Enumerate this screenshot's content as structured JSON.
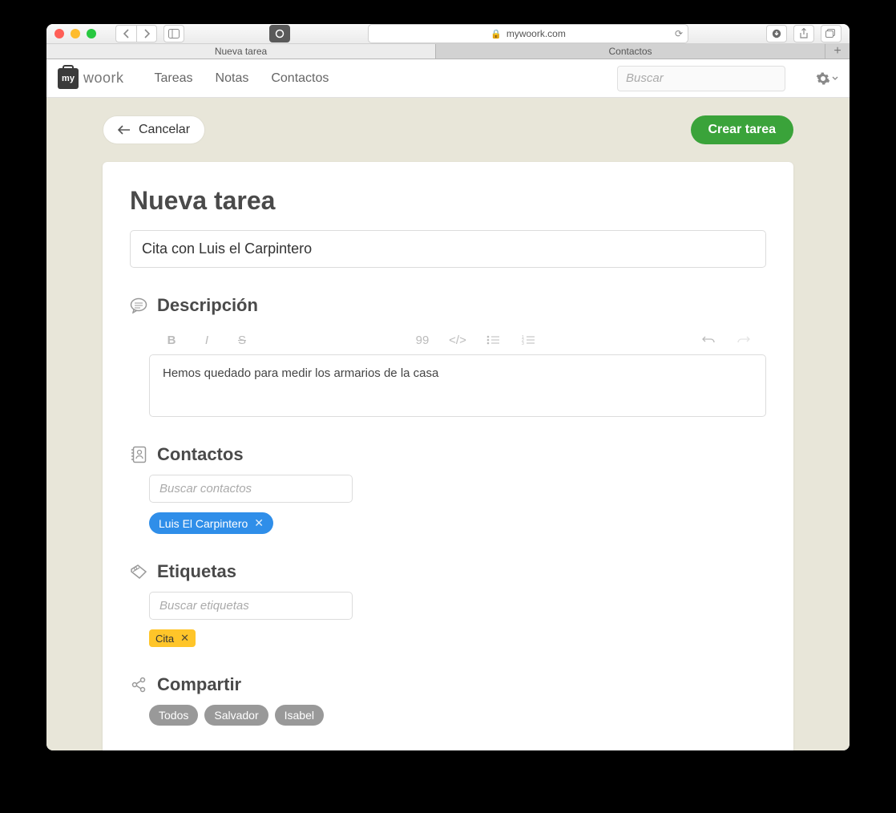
{
  "browser": {
    "url_host": "mywoork.com",
    "tabs": [
      "Nueva tarea",
      "Contactos"
    ],
    "active_tab": 0
  },
  "nav": {
    "brand_prefix": "my",
    "brand_suffix": "woork",
    "links": [
      "Tareas",
      "Notas",
      "Contactos"
    ],
    "search_placeholder": "Buscar"
  },
  "actions": {
    "cancel": "Cancelar",
    "create": "Crear tarea"
  },
  "form": {
    "page_title": "Nueva tarea",
    "title_value": "Cita con Luis el Carpintero",
    "description": {
      "heading": "Descripción",
      "body": "Hemos quedado para medir los armarios de la casa"
    },
    "contacts": {
      "heading": "Contactos",
      "placeholder": "Buscar contactos",
      "selected": [
        {
          "label": "Luis El Carpintero"
        }
      ]
    },
    "tags": {
      "heading": "Etiquetas",
      "placeholder": "Buscar etiquetas",
      "selected": [
        {
          "label": "Cita"
        }
      ]
    },
    "share": {
      "heading": "Compartir",
      "options": [
        "Todos",
        "Salvador",
        "Isabel"
      ]
    }
  }
}
